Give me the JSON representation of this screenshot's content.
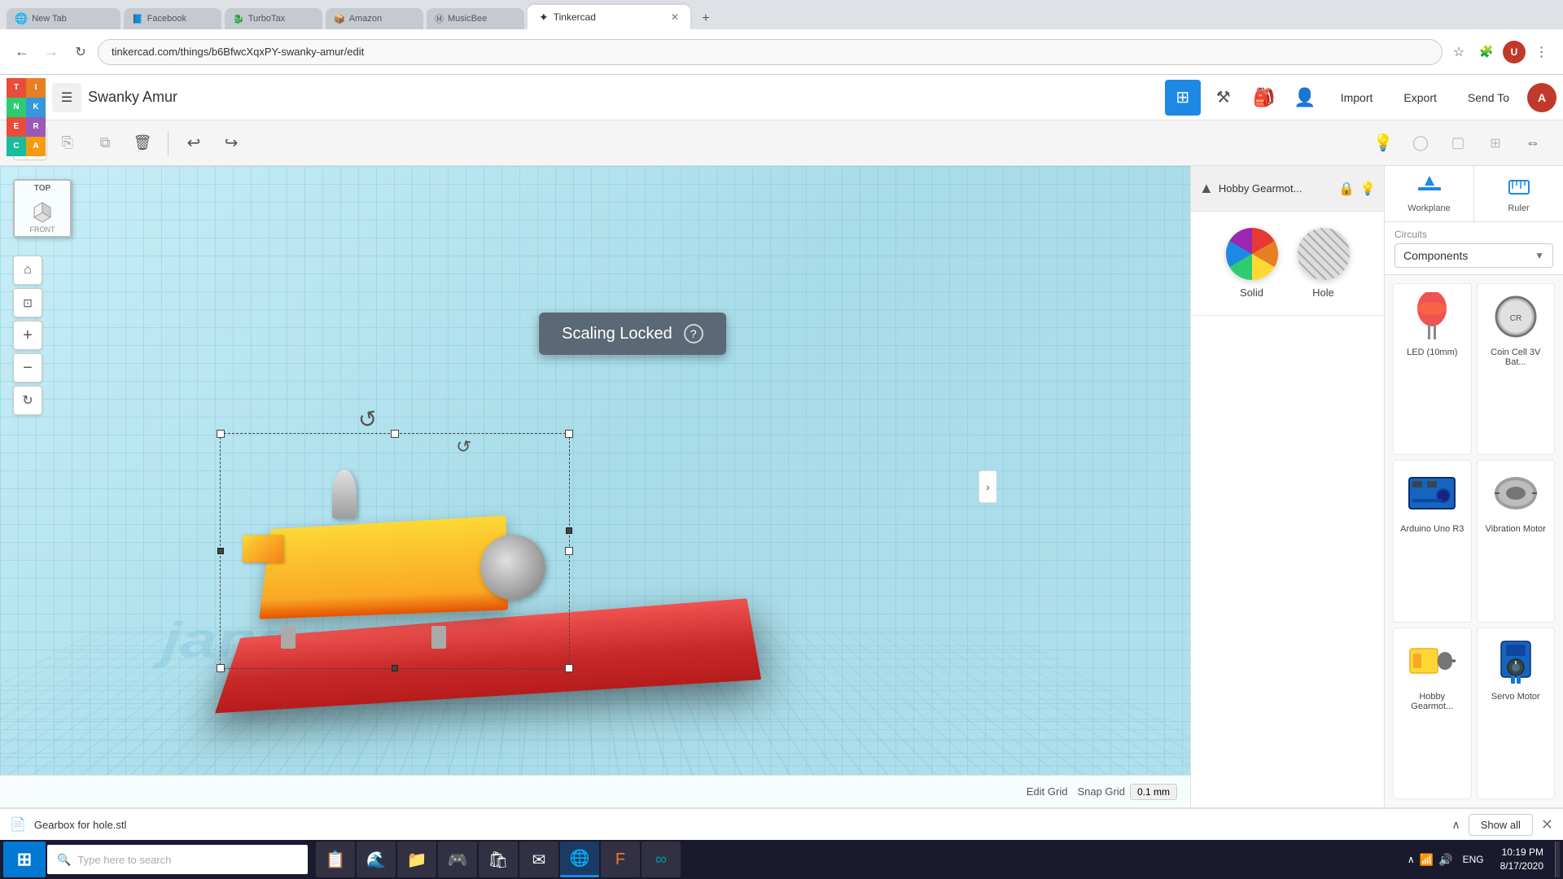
{
  "browser": {
    "active_tab_title": "Tinkercad",
    "url": "tinkercad.com/things/b6BfwcXqxPY-swanky-amur/edit",
    "favicon": "✦"
  },
  "app": {
    "logo_cells": [
      {
        "letter": "T",
        "class": "logo-t"
      },
      {
        "letter": "I",
        "class": "logo-i"
      },
      {
        "letter": "N",
        "class": "logo-n"
      },
      {
        "letter": "K",
        "class": "logo-k"
      },
      {
        "letter": "E",
        "class": "logo-e"
      },
      {
        "letter": "R",
        "class": "logo-r"
      },
      {
        "letter": "C",
        "class": "logo-c"
      },
      {
        "letter": "A",
        "class": "logo-a"
      }
    ],
    "project_name": "Swanky Amur",
    "toolbar": {
      "new_shape": "□",
      "copy": "⎘",
      "duplicate": "⧉",
      "delete": "🗑",
      "undo": "↩",
      "redo": "↪"
    },
    "top_actions": {
      "import": "Import",
      "export": "Export",
      "send_to": "Send To"
    }
  },
  "viewport": {
    "view_cube_top": "TOP",
    "view_cube_front": "FRONT",
    "scaling_locked_label": "Scaling Locked",
    "snap_grid_label": "Snap Grid",
    "snap_grid_value": "0.1 mm",
    "edit_grid_label": "Edit Grid"
  },
  "properties_panel": {
    "component_name": "Hobby Gearmot...",
    "solid_label": "Solid",
    "hole_label": "Hole"
  },
  "sidebar": {
    "category": "Circuits",
    "section": "Components",
    "workplane_label": "Workplane",
    "ruler_label": "Ruler",
    "components": [
      {
        "name": "LED (10mm)",
        "type": "led"
      },
      {
        "name": "Coin Cell 3V Bat...",
        "type": "coin"
      },
      {
        "name": "Arduino Uno R3",
        "type": "arduino"
      },
      {
        "name": "Vibration Motor",
        "type": "vibration"
      },
      {
        "name": "Hobby Gearmot...",
        "type": "hobby"
      },
      {
        "name": "Servo Motor",
        "type": "servo"
      }
    ]
  },
  "status_bar": {
    "filename": "Gearbox for hole.stl",
    "show_all_label": "Show all"
  },
  "taskbar": {
    "search_placeholder": "Type here to search",
    "time": "10:19 PM",
    "date": "8/17/2020",
    "language": "ENG"
  }
}
